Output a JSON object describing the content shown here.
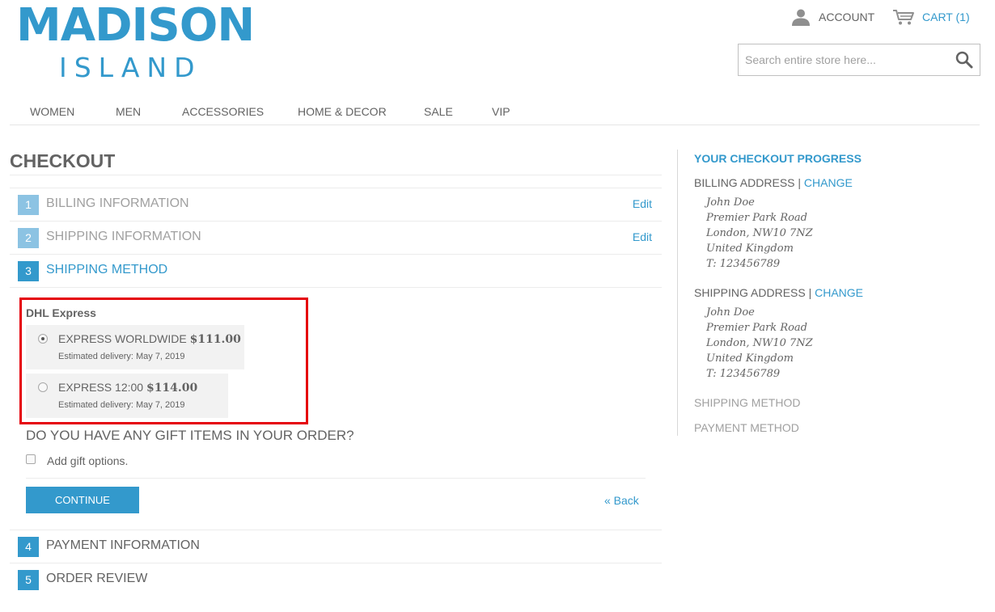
{
  "header": {
    "logo_top": "MADISON",
    "logo_bottom": "ISLAND",
    "account_label": "ACCOUNT",
    "cart_label": "CART (1)",
    "search_placeholder": "Search entire store here...",
    "brand_color": "#3399cc"
  },
  "nav": {
    "items": [
      "WOMEN",
      "MEN",
      "ACCESSORIES",
      "HOME & DECOR",
      "SALE",
      "VIP"
    ]
  },
  "checkout": {
    "title": "CHECKOUT",
    "steps": [
      {
        "num": "1",
        "title": "BILLING INFORMATION",
        "edit": "Edit"
      },
      {
        "num": "2",
        "title": "SHIPPING INFORMATION",
        "edit": "Edit"
      },
      {
        "num": "3",
        "title": "SHIPPING METHOD"
      },
      {
        "num": "4",
        "title": "PAYMENT INFORMATION"
      },
      {
        "num": "5",
        "title": "ORDER REVIEW"
      }
    ],
    "shipping": {
      "carrier": "DHL Express",
      "options": [
        {
          "name": "EXPRESS WORLDWIDE",
          "price": "$111.00",
          "estimate": "Estimated delivery: May 7, 2019",
          "selected": true
        },
        {
          "name": "EXPRESS 12:00",
          "price": "$114.00",
          "estimate": "Estimated delivery: May 7, 2019",
          "selected": false
        }
      ]
    },
    "gift": {
      "title": "DO YOU HAVE ANY GIFT ITEMS IN YOUR ORDER?",
      "checkbox_label": "Add gift options."
    },
    "continue_label": "CONTINUE",
    "back_label": "« Back",
    "highlight_color": "#e5000a"
  },
  "sidebar": {
    "title": "YOUR CHECKOUT PROGRESS",
    "billing_head": "BILLING ADDRESS",
    "separator": " | ",
    "change_label": "CHANGE",
    "billing_address": [
      "John Doe",
      "Premier Park Road",
      "London, NW10 7NZ",
      "United Kingdom",
      "T: 123456789"
    ],
    "shipping_head": "SHIPPING ADDRESS",
    "shipping_address": [
      "John Doe",
      "Premier Park Road",
      "London, NW10 7NZ",
      "United Kingdom",
      "T: 123456789"
    ],
    "shipping_method_head": "SHIPPING METHOD",
    "payment_method_head": "PAYMENT METHOD"
  }
}
